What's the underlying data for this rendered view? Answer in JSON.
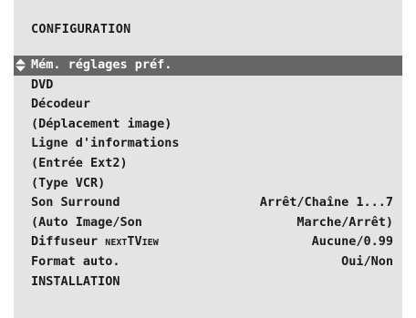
{
  "menu": {
    "title": "CONFIGURATION",
    "items": [
      {
        "label": "Mém. réglages préf.",
        "value": ""
      },
      {
        "label": "DVD",
        "value": ""
      },
      {
        "label": "Décodeur",
        "value": ""
      },
      {
        "label": "(Déplacement image)",
        "value": ""
      },
      {
        "label": "Ligne d'informations",
        "value": ""
      },
      {
        "label": "(Entrée Ext2)",
        "value": ""
      },
      {
        "label": "(Type VCR)",
        "value": ""
      },
      {
        "label": "Son Surround",
        "value": "Arrêt/Chaîne 1...7"
      },
      {
        "label": "(Auto Image/Son",
        "value": "Marche/Arrêt)"
      },
      {
        "label": "Diffuseur",
        "label_brand_small": "next",
        "label_brand": "TV",
        "label_brand_tail": "iew",
        "value": "Aucune/0.99"
      },
      {
        "label": "Format auto.",
        "value": "Oui/Non"
      },
      {
        "label": "INSTALLATION",
        "value": ""
      }
    ],
    "selected_index": 0,
    "selection_icon": "up-down-arrows-icon"
  },
  "colors": {
    "panel_background": "#e4e4e4",
    "highlight_background": "#666666",
    "highlight_text": "#ffffff",
    "text": "#1b1b1b"
  }
}
